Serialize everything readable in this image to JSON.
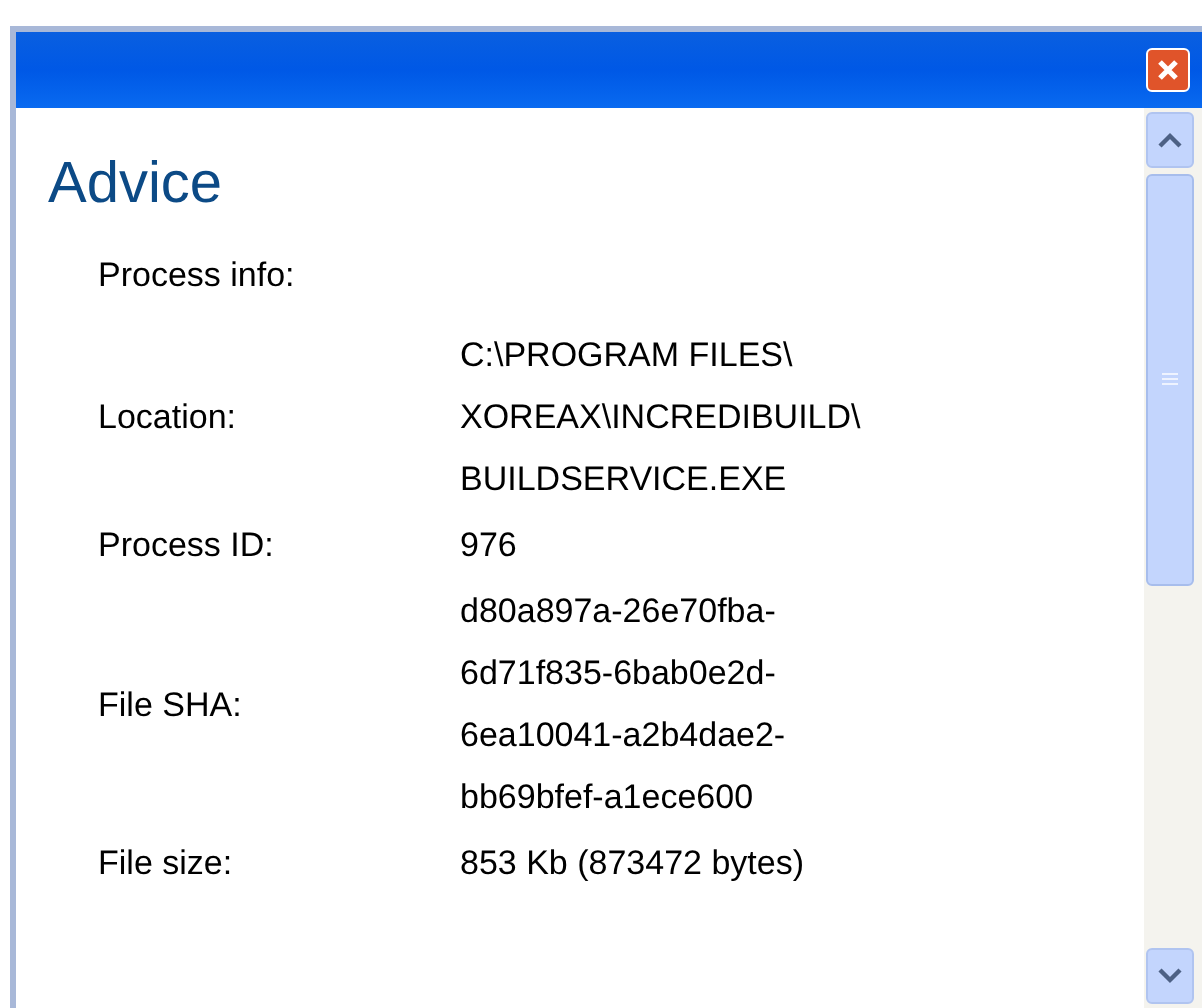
{
  "heading": "Advice",
  "section_label": "Process info:",
  "fields": [
    {
      "label": "Location:",
      "value_lines": [
        "C:\\PROGRAM FILES\\",
        "XOREAX\\INCREDIBUILD\\",
        "BUILDSERVICE.EXE"
      ]
    },
    {
      "label": "Process ID:",
      "value_lines": [
        "976"
      ]
    },
    {
      "label": "File SHA:",
      "value_lines": [
        "d80a897a-26e70fba-",
        "6d71f835-6bab0e2d-",
        "6ea10041-a2b4dae2-",
        "bb69bfef-a1ece600"
      ]
    },
    {
      "label": "File size:",
      "value_lines": [
        "853 Kb (873472 bytes)"
      ]
    }
  ]
}
